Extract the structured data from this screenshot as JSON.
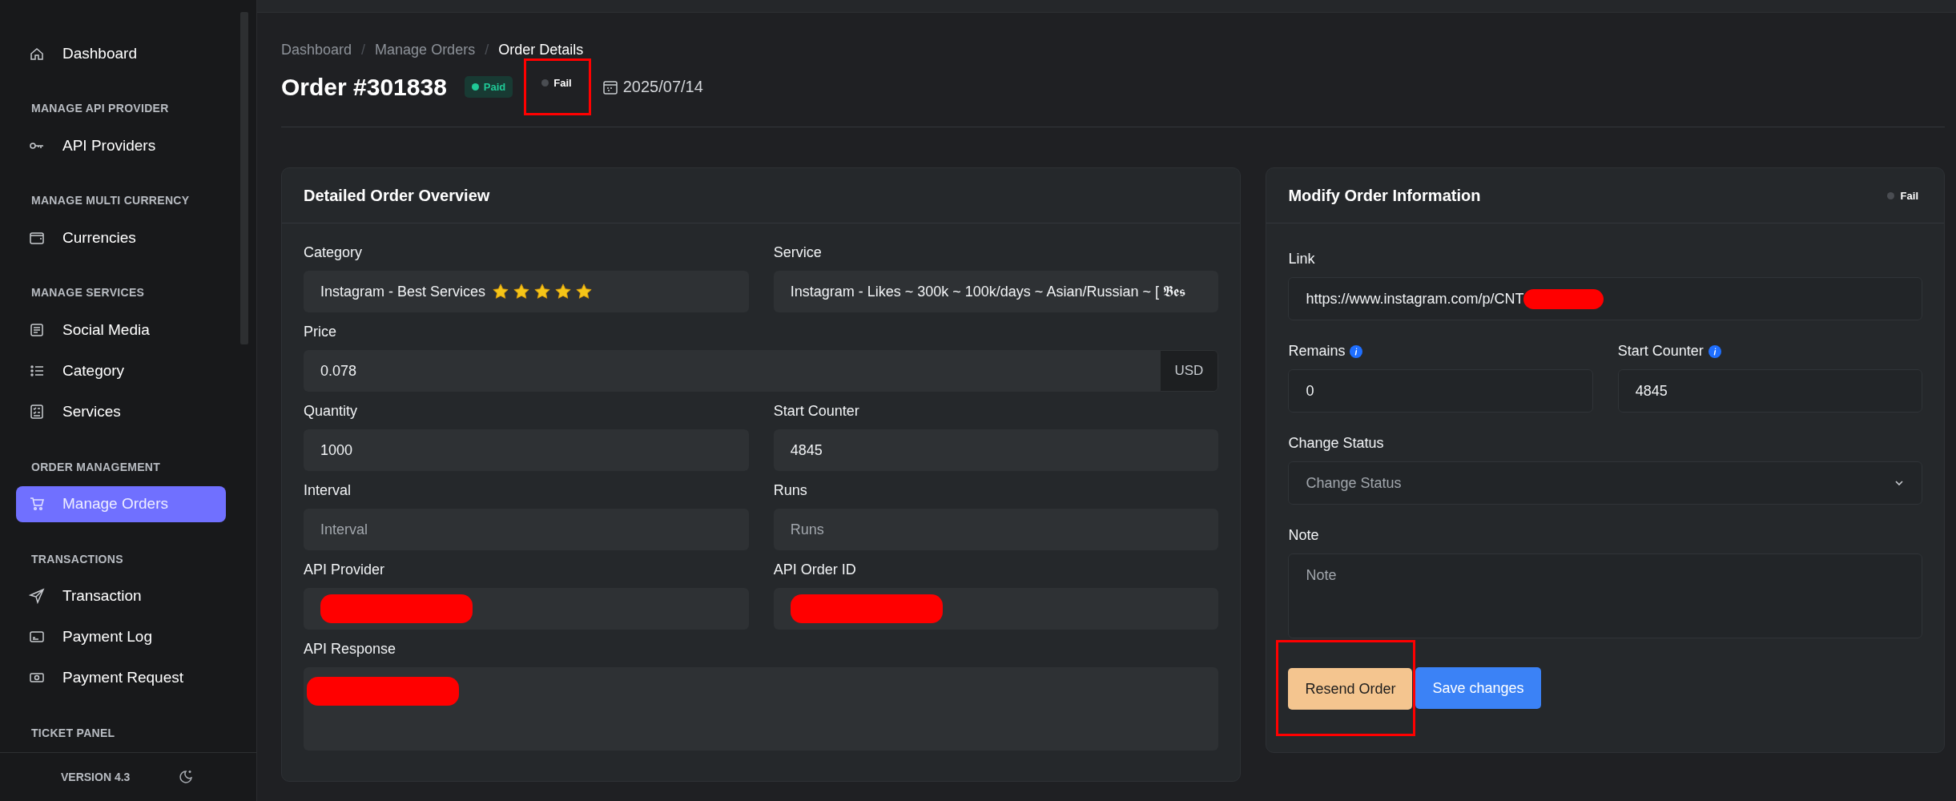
{
  "sidebar": {
    "sections": [
      {
        "items": [
          {
            "label": "Dashboard",
            "selected": false
          }
        ]
      },
      {
        "heading": "MANAGE API PROVIDER",
        "items": [
          {
            "label": "API Providers",
            "selected": false
          }
        ]
      },
      {
        "heading": "MANAGE MULTI CURRENCY",
        "items": [
          {
            "label": "Currencies",
            "selected": false
          }
        ]
      },
      {
        "heading": "MANAGE SERVICES",
        "items": [
          {
            "label": "Social Media",
            "selected": false
          },
          {
            "label": "Category",
            "selected": false
          },
          {
            "label": "Services",
            "selected": false
          }
        ]
      },
      {
        "heading": "ORDER MANAGEMENT",
        "items": [
          {
            "label": "Manage Orders",
            "selected": true
          }
        ]
      },
      {
        "heading": "TRANSACTIONS",
        "items": [
          {
            "label": "Transaction",
            "selected": false
          },
          {
            "label": "Payment Log",
            "selected": false
          },
          {
            "label": "Payment Request",
            "selected": false
          }
        ]
      },
      {
        "heading": "TICKET PANEL"
      }
    ],
    "version": "VERSION 4.3"
  },
  "breadcrumb_separator": "/",
  "breadcrumb": [
    {
      "label": "Dashboard",
      "selected": false
    },
    {
      "label": "Manage Orders",
      "selected": false
    },
    {
      "label": "Order Details",
      "selected": true
    }
  ],
  "title": "Order #301838",
  "badges": [
    {
      "label": "Paid",
      "kind": "paid",
      "highlighted": false
    },
    {
      "label": "Fail",
      "kind": "fail",
      "highlighted": true
    }
  ],
  "date": "2025/07/14",
  "overview": {
    "title": "Detailed Order Overview",
    "fields": [
      {
        "label": "Category",
        "kind": "input",
        "value": "Instagram - Best Services",
        "stars": 5
      },
      {
        "label": "Service",
        "kind": "input",
        "value": "Instagram - Likes ~ 300k ~ 100k/days ~ Asian/Russian ~ [ 𝕭𝖊𝖘"
      },
      {
        "label": "Price",
        "kind": "addon",
        "value": "0.078",
        "addon": "USD"
      },
      {
        "label": "Quantity",
        "kind": "input",
        "value": "1000"
      },
      {
        "label": "Start Counter",
        "kind": "input",
        "value": "4845"
      },
      {
        "label": "Interval",
        "kind": "input",
        "placeholder": "Interval"
      },
      {
        "label": "Runs",
        "kind": "input",
        "placeholder": "Runs"
      },
      {
        "label": "API Provider",
        "kind": "input",
        "redacted": true
      },
      {
        "label": "API Order ID",
        "kind": "input",
        "redacted": true
      },
      {
        "label": "API Response",
        "kind": "textarea",
        "redacted": true
      }
    ]
  },
  "modify": {
    "title": "Modify Order Information",
    "status": {
      "label": "Fail",
      "kind": "fail"
    },
    "fields": [
      {
        "label": "Link",
        "kind": "input",
        "value": "https://www.instagram.com/p/CNT",
        "redacted": true
      },
      {
        "label": "Remains",
        "kind": "input",
        "value": "0",
        "info": true
      },
      {
        "label": "Start Counter",
        "kind": "input",
        "value": "4845",
        "info": true
      },
      {
        "label": "Change Status",
        "kind": "select",
        "value": "Change Status"
      },
      {
        "label": "Note",
        "kind": "textarea",
        "placeholder": "Note"
      }
    ],
    "buttons": [
      {
        "label": "Resend Order",
        "kind": "warning",
        "highlighted": true
      },
      {
        "label": "Save changes",
        "kind": "primary",
        "highlighted": false
      }
    ]
  }
}
